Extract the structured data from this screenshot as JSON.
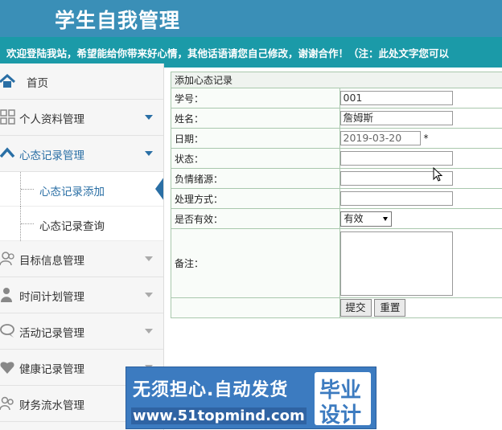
{
  "header": {
    "title": "学生自我管理"
  },
  "notice": {
    "text": "欢迎登陆我站，希望能给你带来好心情，其他话语请您自己修改，谢谢合作！（注：此处文字您可以"
  },
  "sidebar": {
    "items": [
      {
        "label": "首页",
        "icon": "home-icon"
      },
      {
        "label": "个人资料管理",
        "icon": "grid-icon"
      },
      {
        "label": "心态记录管理",
        "icon": "chevron-up-icon",
        "expanded": true,
        "children": [
          {
            "label": "心态记录添加",
            "active": true
          },
          {
            "label": "心态记录查询"
          }
        ]
      },
      {
        "label": "目标信息管理",
        "icon": "users-icon"
      },
      {
        "label": "时间计划管理",
        "icon": "user-icon"
      },
      {
        "label": "活动记录管理",
        "icon": "chat-icon"
      },
      {
        "label": "健康记录管理",
        "icon": "heart-icon"
      },
      {
        "label": "财务流水管理",
        "icon": "user-group-icon"
      }
    ]
  },
  "form": {
    "caption": "添加心态记录",
    "fields": {
      "student_id": {
        "label": "学号：",
        "value": "001"
      },
      "name": {
        "label": "姓名：",
        "value": "詹姆斯"
      },
      "date": {
        "label": "日期：",
        "value": "2019-03-20",
        "required_mark": "*"
      },
      "status": {
        "label": "状态：",
        "value": ""
      },
      "source": {
        "label": "负情绪源：",
        "value": ""
      },
      "handling": {
        "label": "处理方式：",
        "value": ""
      },
      "valid": {
        "label": "是否有效：",
        "value": "有效"
      },
      "remark": {
        "label": "备注：",
        "value": ""
      }
    },
    "submit_label": "提交",
    "reset_label": "重置"
  },
  "watermark": {
    "line1": "无须担心.自动发货",
    "line2": "www.51topmind.com",
    "badge_line1": "毕业",
    "badge_line2": "设计"
  },
  "colors": {
    "header": "#3a8fb7",
    "notice": "#1b9aa8",
    "accent": "#2a6fa5",
    "table_border": "#a9c8ad"
  }
}
